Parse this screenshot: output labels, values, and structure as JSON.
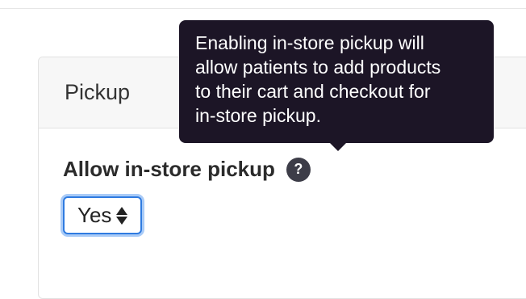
{
  "panel": {
    "title": "Pickup"
  },
  "field": {
    "label": "Allow in-store pickup",
    "help_icon": "question-icon",
    "help_glyph": "?"
  },
  "select": {
    "value": "Yes",
    "icon": "up-down-arrows-icon"
  },
  "tooltip": {
    "lines": [
      "Enabling in-store pickup will",
      "allow patients to add products",
      "to their cart and checkout for",
      "in-store pickup."
    ]
  },
  "colors": {
    "tooltip_bg": "#1c1526",
    "focus_ring": "#2f7be0",
    "help_icon_bg": "#3d3d48"
  }
}
